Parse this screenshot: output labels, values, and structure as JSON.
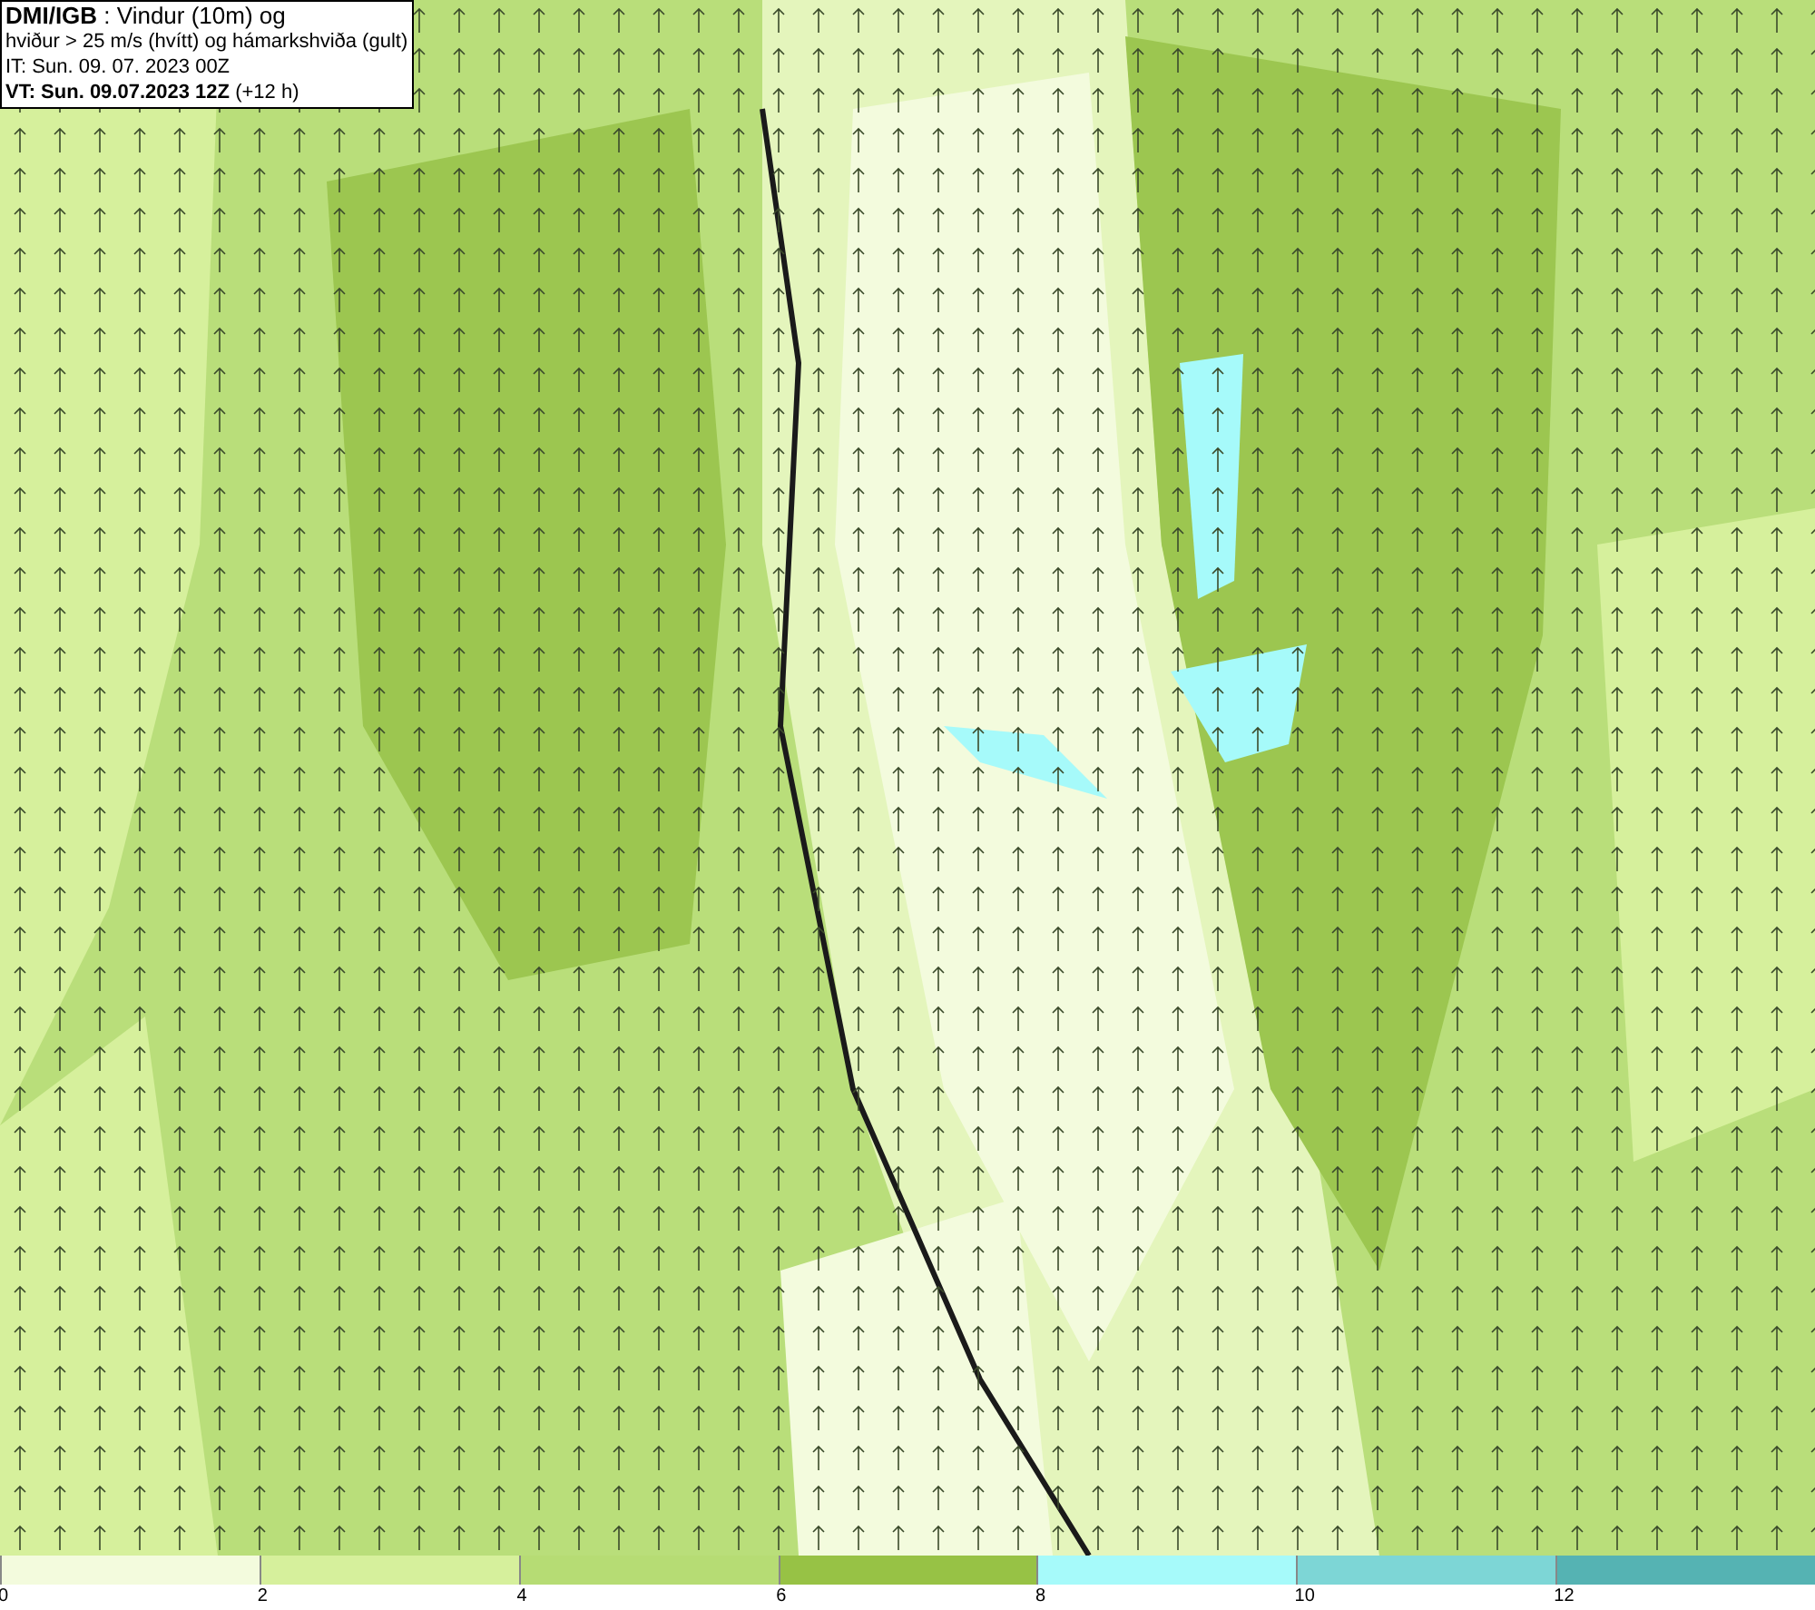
{
  "header": {
    "lines": [
      "**DMI/IGB** : Vindur (10m) og",
      "hviður > 25 m/s (hvítt) og hámarkshviða (gult)",
      "IT: Sun. 09. 07. 2023 00Z",
      "**VT: Sun. 09.07.2023 12Z** (+12 h)"
    ]
  },
  "legend": [
    {
      "label": "0",
      "color": "#f3fbdd"
    },
    {
      "label": "2",
      "color": "#d6f09c"
    },
    {
      "label": "4",
      "color": "#b6dc74"
    },
    {
      "label": "6",
      "color": "#97c245"
    },
    {
      "label": "8",
      "color": "#a6fafa"
    },
    {
      "label": "10",
      "color": "#7dd6d6"
    },
    {
      "label": "12",
      "color": "#55b3b3"
    }
  ]
}
